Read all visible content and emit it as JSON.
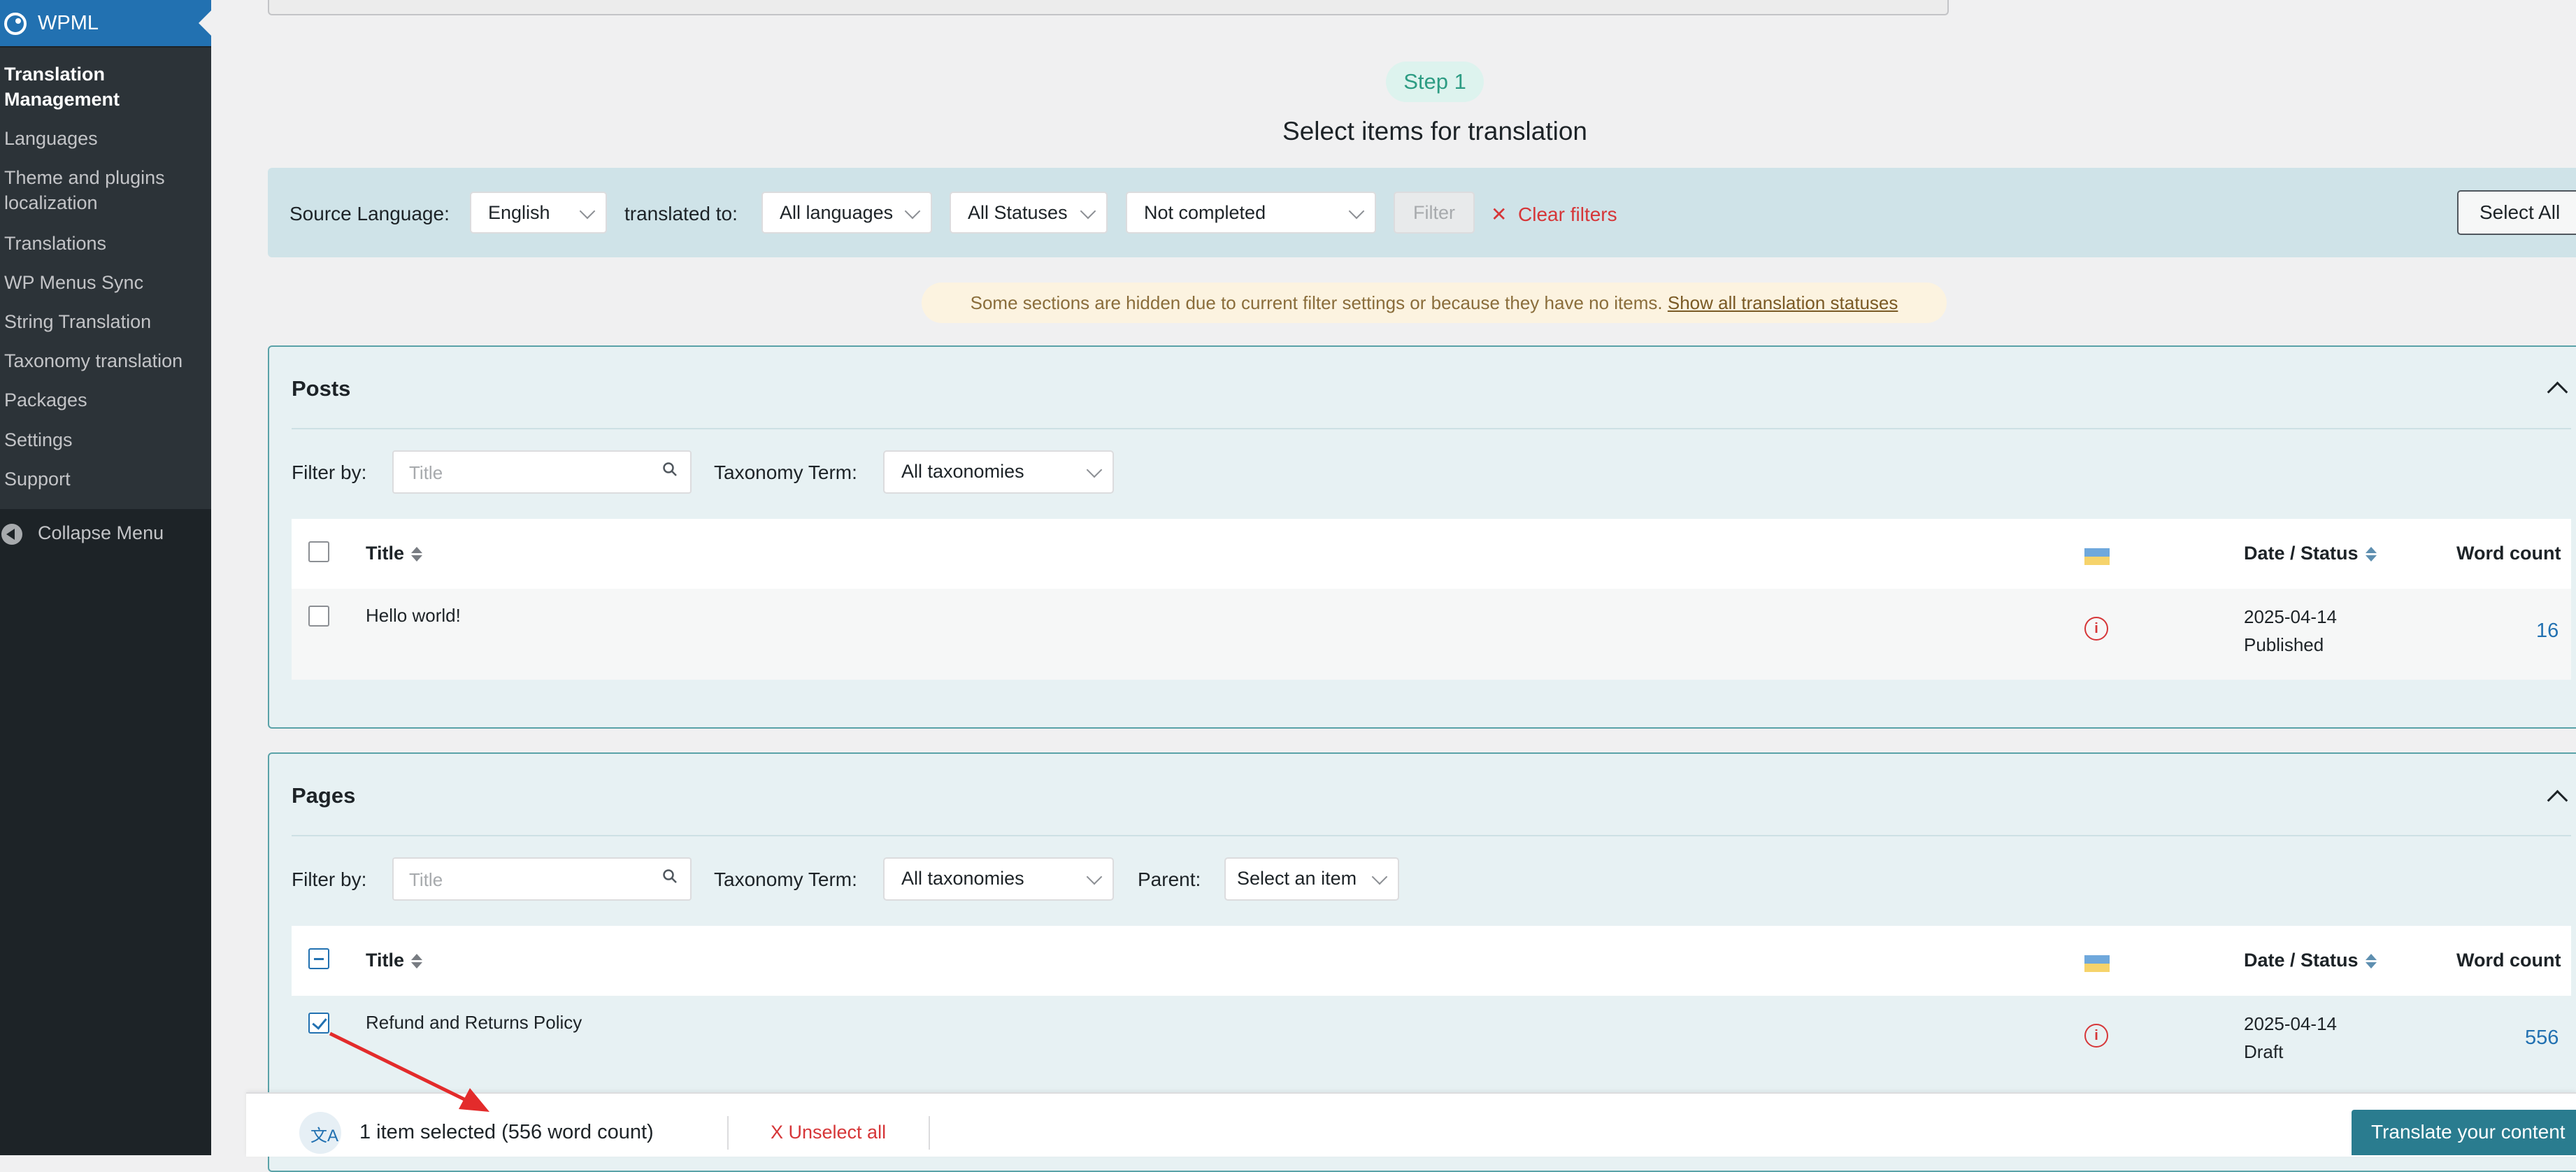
{
  "sidebar": {
    "title": "WPML",
    "items": [
      {
        "label_line1": "Translation",
        "label_line2": "Management"
      },
      {
        "label": "Languages"
      },
      {
        "label_line1": "Theme and plugins",
        "label_line2": "localization"
      },
      {
        "label": "Translations"
      },
      {
        "label": "WP Menus Sync"
      },
      {
        "label": "String Translation"
      },
      {
        "label": "Taxonomy translation"
      },
      {
        "label": "Packages"
      },
      {
        "label": "Settings"
      },
      {
        "label": "Support"
      }
    ],
    "collapse_label": "Collapse Menu"
  },
  "step": {
    "label": "Step 1",
    "heading": "Select items for translation"
  },
  "filters": {
    "source_language_label": "Source Language:",
    "source_language_value": "English",
    "translated_to_label": "translated to:",
    "translated_to_value": "All languages",
    "status_value": "All Statuses",
    "completion_value": "Not completed",
    "filter_button": "Filter",
    "clear_filters": "Clear filters",
    "select_all": "Select All"
  },
  "notice": {
    "text": "Some sections are hidden due to current filter settings or because they have no items.",
    "link": "Show all translation statuses"
  },
  "posts": {
    "title": "Posts",
    "filter_by_label": "Filter by:",
    "search_placeholder": "Title",
    "taxonomy_label": "Taxonomy Term:",
    "taxonomy_value": "All taxonomies",
    "columns": {
      "title": "Title",
      "date_status": "Date / Status",
      "word_count": "Word count"
    },
    "rows": [
      {
        "title": "Hello world!",
        "date": "2025-04-14",
        "status": "Published",
        "word_count": "16"
      }
    ]
  },
  "pages": {
    "title": "Pages",
    "filter_by_label": "Filter by:",
    "search_placeholder": "Title",
    "taxonomy_label": "Taxonomy Term:",
    "taxonomy_value": "All taxonomies",
    "parent_label": "Parent:",
    "parent_value": "Select an item",
    "columns": {
      "title": "Title",
      "date_status": "Date / Status",
      "word_count": "Word count"
    },
    "rows": [
      {
        "title": "Refund and Returns Policy",
        "date": "2025-04-14",
        "status": "Draft",
        "word_count": "556"
      }
    ]
  },
  "bottom_bar": {
    "selected_text": "1 item selected (556 word count)",
    "unselect_all": "X Unselect all",
    "translate_button": "Translate your content"
  },
  "colors": {
    "sidebar_bg": "#1d2327",
    "wpml_blue": "#2271b1",
    "section_bg": "#e7f1f3",
    "filter_bg": "#cfe3e8",
    "danger": "#d63638",
    "teal_button": "#2a7c8f",
    "annotation_arrow": "#e32b2b"
  }
}
